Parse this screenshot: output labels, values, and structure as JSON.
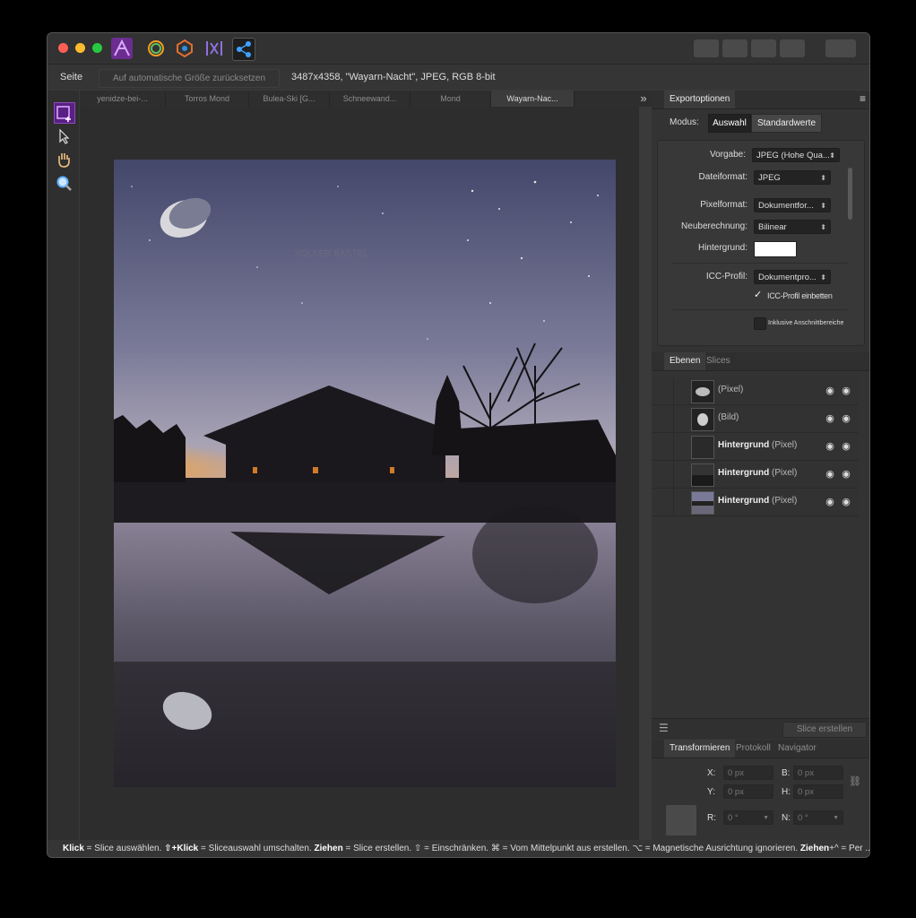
{
  "context": {
    "page_label": "Seite",
    "reset_button": "Auf automatische Größe zurücksetzen",
    "doc_info": "3487x4358, \"Wayarn-Nacht\", JPEG, RGB 8-bit"
  },
  "tabs": [
    {
      "label": "yenidze-bei-..."
    },
    {
      "label": "Torros Mond"
    },
    {
      "label": "Bulea-Ski [G..."
    },
    {
      "label": "Schneewand..."
    },
    {
      "label": "Mond"
    },
    {
      "label": "Wayarn-Nac..."
    }
  ],
  "tab_overflow_icon": "»",
  "export": {
    "panel_title": "Exportoptionen",
    "mode_label": "Modus:",
    "mode_options": [
      "Auswahl",
      "Standardwerte"
    ],
    "fields": {
      "preset_label": "Vorgabe:",
      "preset_value": "JPEG (Hohe Qua...",
      "format_label": "Dateiformat:",
      "format_value": "JPEG",
      "pixelformat_label": "Pixelformat:",
      "pixelformat_value": "Dokumentfor...",
      "resample_label": "Neuberechnung:",
      "resample_value": "Bilinear",
      "background_label": "Hintergrund:",
      "icc_label": "ICC-Profil:",
      "icc_value": "Dokumentpro...",
      "icc_embed": "ICC-Profil einbetten",
      "include_slices": "Inklusive Anschnittbereiche"
    }
  },
  "layers": {
    "tabs": [
      "Ebenen",
      "Slices"
    ],
    "rows": [
      {
        "name": "",
        "type": "(Pixel)"
      },
      {
        "name": "",
        "type": "(Bild)"
      },
      {
        "name": "Hintergrund",
        "type": "(Pixel)"
      },
      {
        "name": "Hintergrund",
        "type": "(Pixel)"
      },
      {
        "name": "Hintergrund",
        "type": "(Pixel)"
      }
    ],
    "create_slice": "Slice erstellen"
  },
  "transform": {
    "tabs": [
      "Transformieren",
      "Protokoll",
      "Navigator"
    ],
    "x_label": "X:",
    "x_value": "0 px",
    "y_label": "Y:",
    "y_value": "0 px",
    "b_label": "B:",
    "b_value": "0 px",
    "h_label": "H:",
    "h_value": "0 px",
    "r_label": "R:",
    "r_value": "0 °",
    "n_label": "N:",
    "n_value": "0 °"
  },
  "status": {
    "s1": "Klick",
    "t1": " = Slice auswählen. ",
    "s2": "⇧+Klick",
    "t2": " = Sliceauswahl umschalten. ",
    "s3": "Ziehen",
    "t3": " = Slice erstellen. ⇧ = Einschränken. ⌘ = Vom Mittelpunkt aus erstellen. ⌥ = Magnetische Ausrichtung ignorieren. ",
    "s4": "Ziehen",
    "t4": "+^ = Per ..."
  },
  "photo_watermark": "VOLKER BASTEL",
  "colors": {
    "accent": "#8a2be2",
    "window": "#3a3a3a",
    "panel": "#333333"
  }
}
